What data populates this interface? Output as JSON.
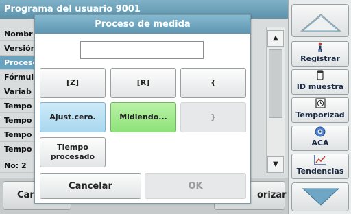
{
  "background": {
    "title": "Programa del usuario 9001",
    "rows": [
      "Nombr",
      "Versión",
      "Proceso",
      "Fórmul",
      "Variab",
      "Tempo",
      "Tempo",
      "Tempo",
      "Tempo",
      "No: 2"
    ],
    "selected_row_index": 2,
    "bottom_left_label": "Car",
    "bottom_right_label": "orizar"
  },
  "sidebar": {
    "buttons": [
      {
        "label": "Registrar",
        "icon": "person-icon",
        "glyph": "🚶"
      },
      {
        "label": "ID muestra",
        "icon": "sample-vial-icon",
        "glyph": "▭"
      },
      {
        "label": "Temporizad",
        "icon": "timer-icon",
        "glyph": "◷"
      },
      {
        "label": "ACA",
        "icon": "aca-icon",
        "glyph": "◉"
      },
      {
        "label": "Tendencias",
        "icon": "trend-chart-icon",
        "glyph": "⟋"
      }
    ]
  },
  "dialog": {
    "title": "Proceso de medida",
    "input_value": "",
    "row1": [
      "[Z]",
      "[R]",
      "{"
    ],
    "row2": [
      "Ajust.cero.",
      "Midiendo...",
      "}"
    ],
    "row3_line1": "Tiempo",
    "row3_line2": "procesado",
    "cancel_label": "Cancelar",
    "ok_label": "OK"
  },
  "colors": {
    "title_bar": "#5f95b0",
    "selected_row": "#6aa3c0",
    "zero_button": "#a9d7ef",
    "measuring_button": "#8ee27a",
    "nav_arrows": "#6fa6c4"
  }
}
